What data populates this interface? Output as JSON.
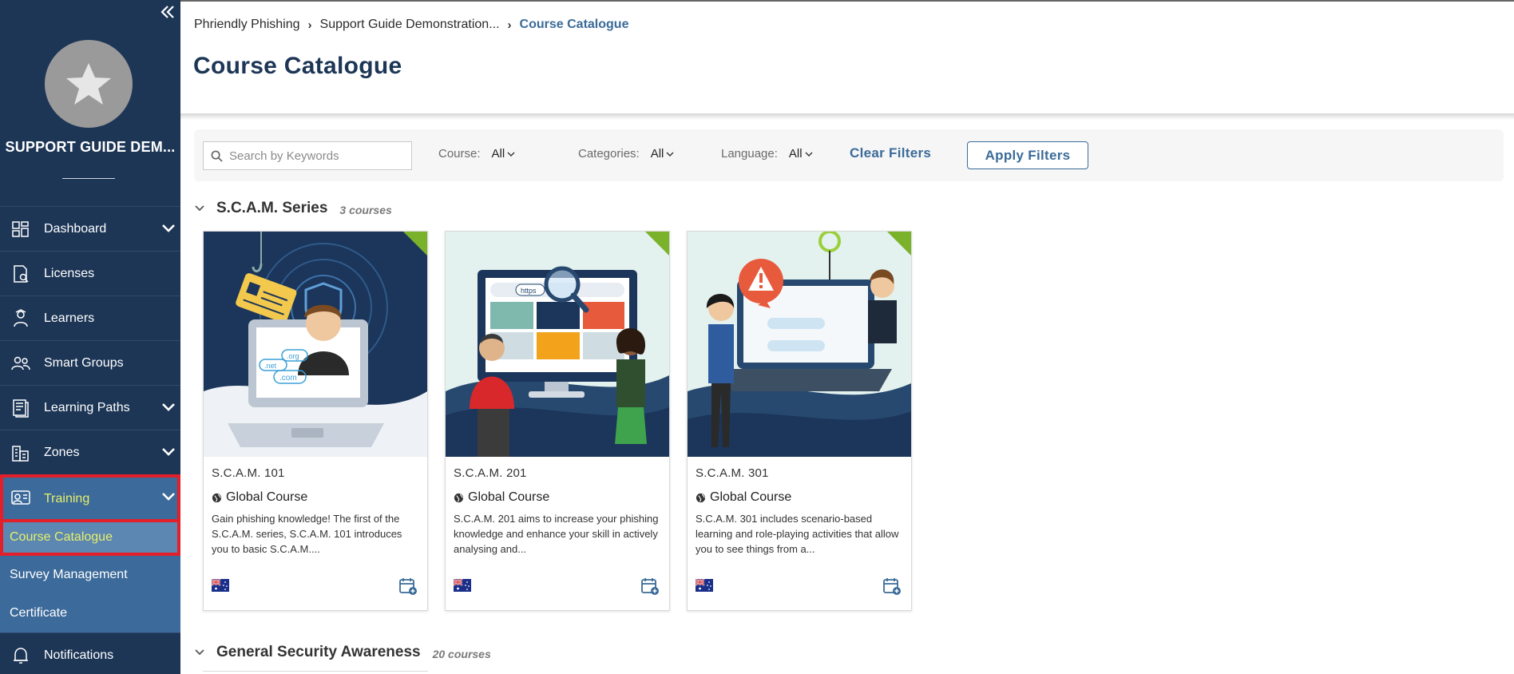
{
  "sidebar": {
    "org_name": "SUPPORT GUIDE DEM...",
    "nav": [
      {
        "label": "Dashboard",
        "icon": "dashboard-icon",
        "has_chevron": true
      },
      {
        "label": "Licenses",
        "icon": "license-icon",
        "has_chevron": false
      },
      {
        "label": "Learners",
        "icon": "learner-icon",
        "has_chevron": false
      },
      {
        "label": "Smart Groups",
        "icon": "group-icon",
        "has_chevron": false
      },
      {
        "label": "Learning Paths",
        "icon": "learning-path-icon",
        "has_chevron": true
      },
      {
        "label": "Zones",
        "icon": "buildings-icon",
        "has_chevron": true
      },
      {
        "label": "Training",
        "icon": "training-icon",
        "has_chevron": true,
        "active": true
      }
    ],
    "training_sub": [
      {
        "label": "Course Catalogue",
        "active": true
      },
      {
        "label": "Survey Management"
      },
      {
        "label": "Certificate"
      }
    ],
    "notifications": {
      "label": "Notifications",
      "icon": "bell-icon"
    },
    "colors": {
      "bg": "#1d3656",
      "active_bg": "#3c6a9a",
      "sub_active_bg": "#5b87b2",
      "active_text": "#e7ef6a",
      "highlight": "#e3202a"
    }
  },
  "breadcrumb": {
    "items": [
      "Phriendly Phishing",
      "Support Guide Demonstration..."
    ],
    "current": "Course Catalogue"
  },
  "page_title": "Course Catalogue",
  "filters": {
    "search_placeholder": "Search by Keywords",
    "course": {
      "label": "Course:",
      "value": "All"
    },
    "categories": {
      "label": "Categories:",
      "value": "All"
    },
    "language": {
      "label": "Language:",
      "value": "All"
    },
    "clear_label": "Clear Filters",
    "apply_label": "Apply Filters"
  },
  "sections": [
    {
      "title": "S.C.A.M. Series",
      "count": "3 courses",
      "courses": [
        {
          "title": "S.C.A.M. 101",
          "scope": "Global Course",
          "description": "Gain phishing knowledge! The first of the S.C.A.M. series, S.C.A.M. 101 introduces you to basic S.C.A.M....",
          "flag": "australia-flag-icon"
        },
        {
          "title": "S.C.A.M. 201",
          "scope": "Global Course",
          "description": "S.C.A.M. 201 aims to increase your phishing knowledge and enhance your skill in actively analysing and...",
          "flag": "australia-flag-icon"
        },
        {
          "title": "S.C.A.M. 301",
          "scope": "Global Course",
          "description": "S.C.A.M. 301 includes scenario-based learning and role-playing activities that allow you to see things from a...",
          "flag": "australia-flag-icon"
        }
      ]
    },
    {
      "title": "General Security Awareness",
      "count": "20 courses"
    }
  ],
  "illustrations": {
    "scam101": {
      "domains": [
        ".org",
        ".net",
        ".com"
      ]
    },
    "scam201": {
      "url": "https"
    }
  },
  "accent": {
    "primary": "#3a6b98",
    "new_corner": "#7bb22b"
  }
}
